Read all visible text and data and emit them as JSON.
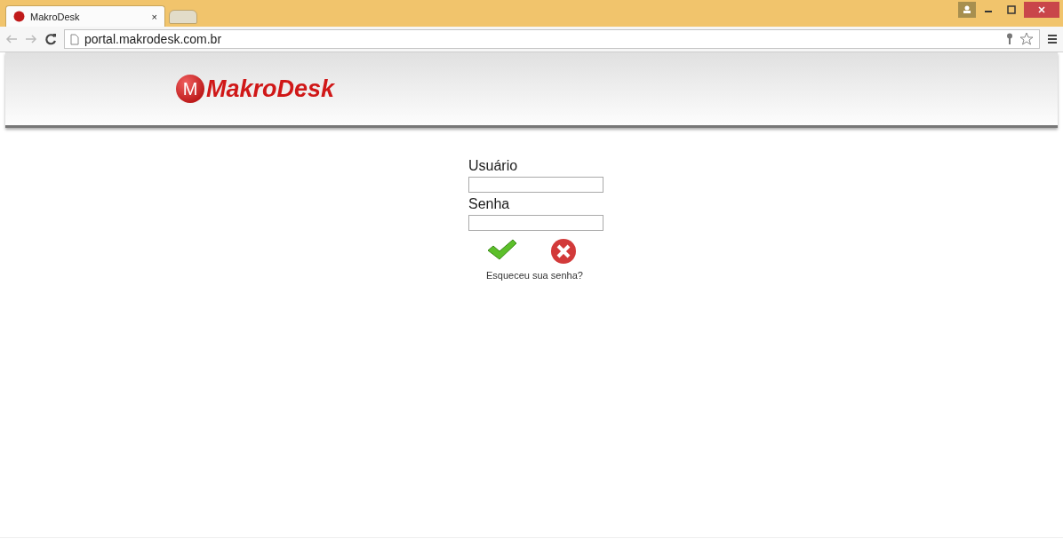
{
  "browser": {
    "tabs": [
      {
        "title": "MakroDesk",
        "close": "×",
        "selected": true
      }
    ],
    "address": "portal.makrodesk.com.br"
  },
  "header": {
    "logo_mark": "M",
    "logo_text": "MakroDesk"
  },
  "form": {
    "fields": [
      {
        "label": "Usuário"
      },
      {
        "label": "Senha"
      }
    ],
    "forgot_link": "Esqueceu sua senha?"
  }
}
